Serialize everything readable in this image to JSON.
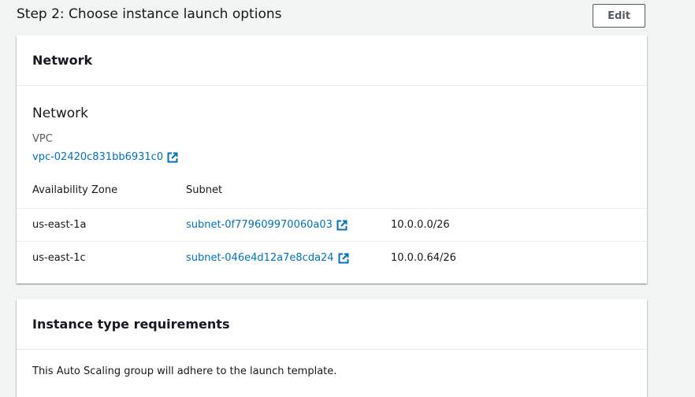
{
  "step": {
    "title": "Step 2: Choose instance launch options",
    "edit_label": "Edit"
  },
  "network_card": {
    "header": "Network",
    "section_title": "Network",
    "vpc_label": "VPC",
    "vpc_id": "vpc-02420c831bb6931c0",
    "columns": {
      "az": "Availability Zone",
      "subnet": "Subnet"
    },
    "rows": [
      {
        "az": "us-east-1a",
        "subnet": "subnet-0f779609970060a03",
        "cidr": "10.0.0.0/26"
      },
      {
        "az": "us-east-1c",
        "subnet": "subnet-046e4d12a7e8cda24",
        "cidr": "10.0.0.64/26"
      }
    ]
  },
  "instance_card": {
    "header": "Instance type requirements",
    "body": "This Auto Scaling group will adhere to the launch template."
  },
  "icons": {
    "external_link": "external-link-icon"
  },
  "colors": {
    "link": "#0073bb",
    "background": "#f2f3f3",
    "text": "#16191f",
    "secondary_text": "#545b64"
  }
}
